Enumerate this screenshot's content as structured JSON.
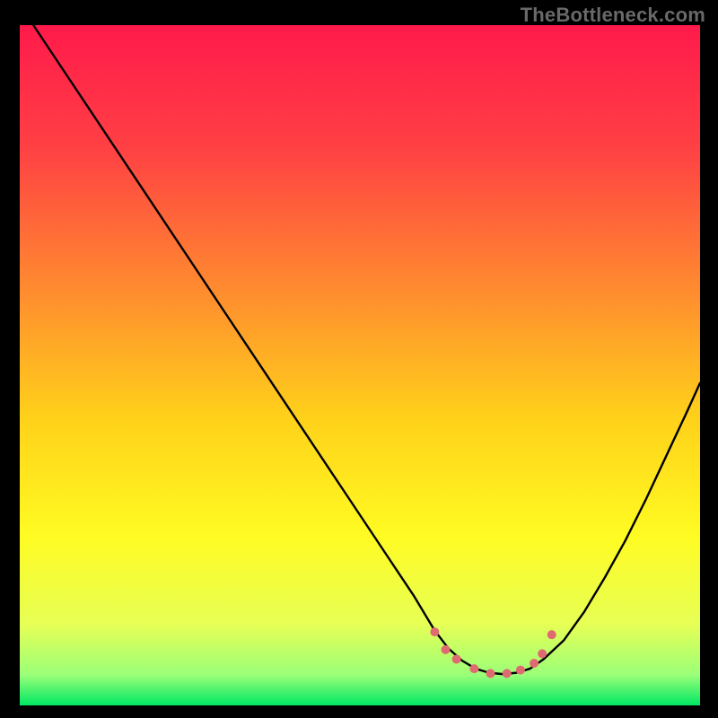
{
  "watermark": "TheBottleneck.com",
  "chart_data": {
    "type": "line",
    "title": "",
    "xlabel": "",
    "ylabel": "",
    "xlim": [
      0,
      100
    ],
    "ylim": [
      0,
      100
    ],
    "grid": false,
    "legend": false,
    "background_gradient": {
      "stops": [
        {
          "offset": 0.0,
          "color": "#ff1a4b"
        },
        {
          "offset": 0.18,
          "color": "#ff4044"
        },
        {
          "offset": 0.4,
          "color": "#ff8f2e"
        },
        {
          "offset": 0.58,
          "color": "#ffd21a"
        },
        {
          "offset": 0.75,
          "color": "#fffb22"
        },
        {
          "offset": 0.88,
          "color": "#e7ff55"
        },
        {
          "offset": 0.955,
          "color": "#9bff78"
        },
        {
          "offset": 1.0,
          "color": "#00e864"
        }
      ]
    },
    "series": [
      {
        "name": "bottleneck-curve",
        "color": "#000000",
        "width": 2.4,
        "x": [
          2,
          6,
          10,
          14,
          18,
          22,
          26,
          30,
          34,
          38,
          42,
          46,
          50,
          54,
          58,
          61,
          63,
          65,
          67,
          69,
          71,
          73,
          75,
          77,
          80,
          83,
          86,
          89,
          92,
          95,
          98,
          100
        ],
        "y": [
          100,
          94,
          88,
          82,
          76,
          70,
          64,
          58,
          52,
          46,
          40,
          34,
          28,
          22,
          16,
          11,
          8.4,
          6.6,
          5.4,
          4.8,
          4.6,
          4.8,
          5.4,
          6.8,
          9.6,
          13.8,
          18.8,
          24.2,
          30.2,
          36.6,
          43.0,
          47.4
        ]
      }
    ],
    "markers": {
      "color": "#e06a71",
      "radius": 5.0,
      "points": [
        {
          "x": 61.0,
          "y": 10.8
        },
        {
          "x": 62.6,
          "y": 8.2
        },
        {
          "x": 64.2,
          "y": 6.8
        },
        {
          "x": 66.8,
          "y": 5.4
        },
        {
          "x": 69.2,
          "y": 4.7
        },
        {
          "x": 71.6,
          "y": 4.7
        },
        {
          "x": 73.6,
          "y": 5.2
        },
        {
          "x": 75.6,
          "y": 6.2
        },
        {
          "x": 76.8,
          "y": 7.6
        },
        {
          "x": 78.2,
          "y": 10.4
        }
      ]
    }
  }
}
